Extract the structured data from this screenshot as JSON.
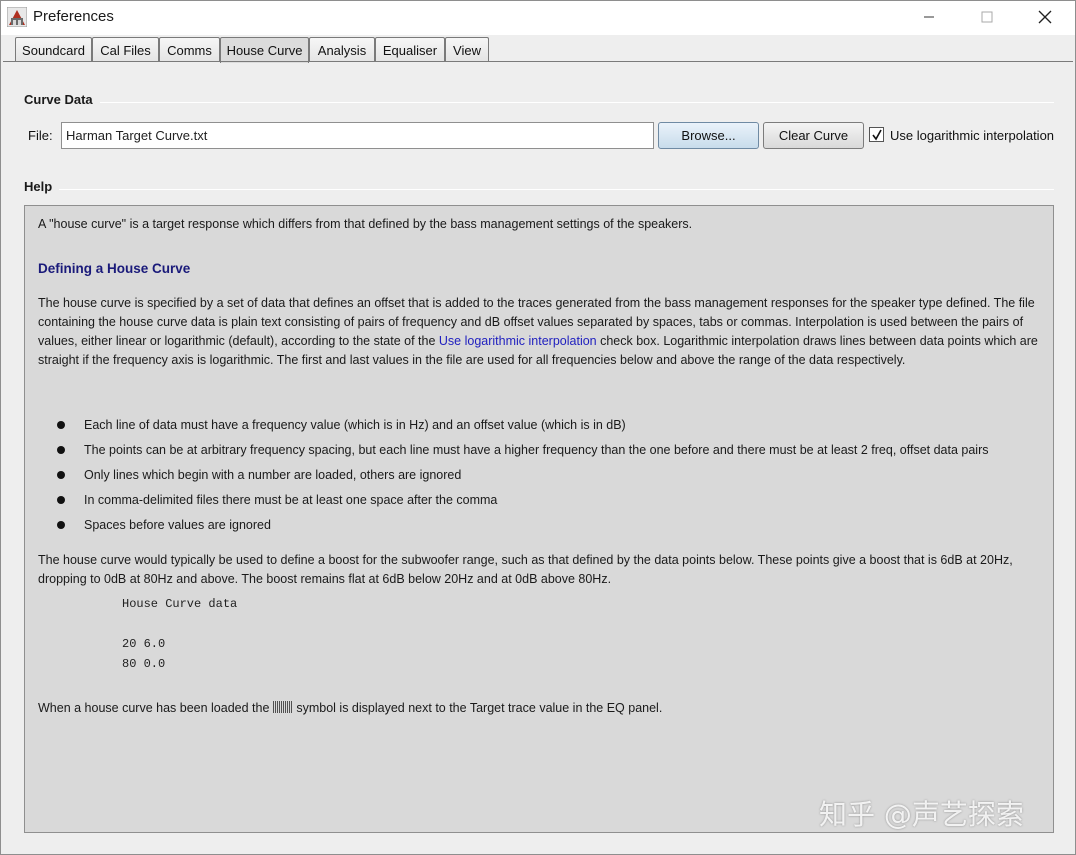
{
  "window": {
    "title": "Preferences"
  },
  "tabs": [
    {
      "label": "Soundcard"
    },
    {
      "label": "Cal Files"
    },
    {
      "label": "Comms"
    },
    {
      "label": "House Curve"
    },
    {
      "label": "Analysis"
    },
    {
      "label": "Equaliser"
    },
    {
      "label": "View"
    }
  ],
  "active_tab": "House Curve",
  "curve_data": {
    "section_title": "Curve Data",
    "file_label": "File:",
    "file_value": "Harman Target Curve.txt",
    "browse_label": "Browse...",
    "clear_label": "Clear Curve",
    "log_interp_checked": true,
    "log_interp_label": "Use logarithmic interpolation"
  },
  "help": {
    "section_title": "Help",
    "intro": "A \"house curve\" is a target response which differs from that defined by the bass management settings of the speakers.",
    "heading": "Defining a House Curve",
    "para1_a": "The house curve is specified by a set of data that defines an offset that is added to the traces generated from the bass management responses for the speaker type defined. The file containing the house curve data is plain text consisting of pairs of frequency and dB offset values separated by spaces, tabs or commas. Interpolation is used between the pairs of values, either linear or logarithmic (default), according to the state of the ",
    "para1_link": "Use logarithmic interpolation",
    "para1_b": " check box. Logarithmic interpolation draws lines between data points which are straight if the frequency axis is logarithmic. The first and last values in the file are used for all frequencies below and above the range of the data respectively.",
    "bullets": [
      "Each line of data must have a frequency value (which is in Hz) and an offset value (which is in dB)",
      "The points can be at arbitrary frequency spacing, but each line must have a higher frequency than the one before and there must be at least 2 freq, offset data pairs",
      "Only lines which begin with a number are loaded, others are ignored",
      "In comma-delimited files there must be at least one space after the comma",
      "Spaces before values are ignored"
    ],
    "para2": "The house curve would typically be used to define a boost for the subwoofer range, such as that defined by the data points below. These points give a boost that is 6dB at 20Hz, dropping to 0dB at 80Hz and above. The boost remains flat at 6dB below 20Hz and at 0dB above 80Hz.",
    "code_lines": [
      "House Curve data",
      "20 6.0",
      "80 0.0"
    ],
    "para3_a": "When a house curve has been loaded the ",
    "para3_b": " symbol is displayed next to the Target trace value in the EQ panel."
  },
  "watermark": "知乎 @声艺探索"
}
